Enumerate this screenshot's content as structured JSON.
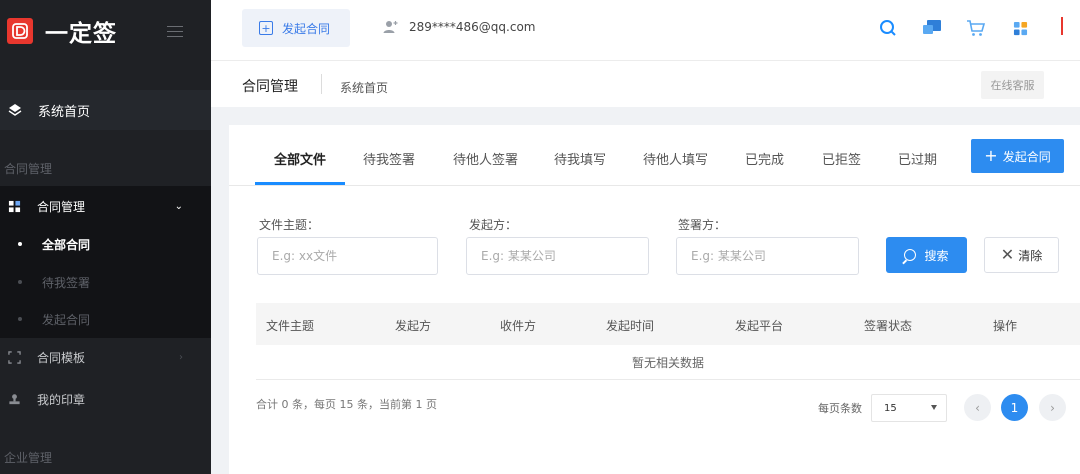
{
  "sidebar": {
    "brand": "一定签",
    "home_label": "系统首页",
    "section_contracts": "合同管理",
    "section_enterprise": "企业管理",
    "items": [
      {
        "label": "合同管理",
        "expanded": true
      },
      {
        "label": "合同模板",
        "expanded": false
      },
      {
        "label": "我的印章",
        "expanded": false
      }
    ],
    "subitems": [
      {
        "label": "全部合同",
        "active": true
      },
      {
        "label": "待我签署",
        "active": false
      },
      {
        "label": "发起合同",
        "active": false
      }
    ]
  },
  "topbar": {
    "start_contract_label": "发起合同",
    "user_account": "289****486@qq.com",
    "icons": [
      "search-icon",
      "chat-icon",
      "cart-icon",
      "grid-apps-icon"
    ]
  },
  "breadcrumb": {
    "title": "合同管理",
    "current": "系统首页",
    "support_label": "在线客服"
  },
  "tabs": [
    {
      "label": "全部文件",
      "active": true
    },
    {
      "label": "待我签署",
      "active": false
    },
    {
      "label": "待他人签署",
      "active": false
    },
    {
      "label": "待我填写",
      "active": false
    },
    {
      "label": "待他人填写",
      "active": false
    },
    {
      "label": "已完成",
      "active": false
    },
    {
      "label": "已拒签",
      "active": false
    },
    {
      "label": "已过期",
      "active": false
    }
  ],
  "new_contract_button": "发起合同",
  "filters": {
    "subject": {
      "label": "文件主题：",
      "placeholder": "E.g: xx文件",
      "value": ""
    },
    "sender": {
      "label": "发起方：",
      "placeholder": "E.g: 某某公司",
      "value": ""
    },
    "signer": {
      "label": "签署方：",
      "placeholder": "E.g: 某某公司",
      "value": ""
    },
    "search_label": "搜索",
    "clear_label": "清除"
  },
  "table": {
    "columns": [
      "文件主题",
      "发起方",
      "收件方",
      "发起时间",
      "发起平台",
      "签署状态",
      "操作"
    ],
    "empty_text": "暂无相关数据"
  },
  "pagination": {
    "summary": "合计 0 条，每页 15 条，当前第 1 页",
    "page_size_label": "每页条数",
    "page_size": "15",
    "current_page": "1"
  },
  "colors": {
    "accent": "#2d8cf0",
    "sidebar_bg": "#1f2125",
    "logo_red": "#e8372e"
  }
}
